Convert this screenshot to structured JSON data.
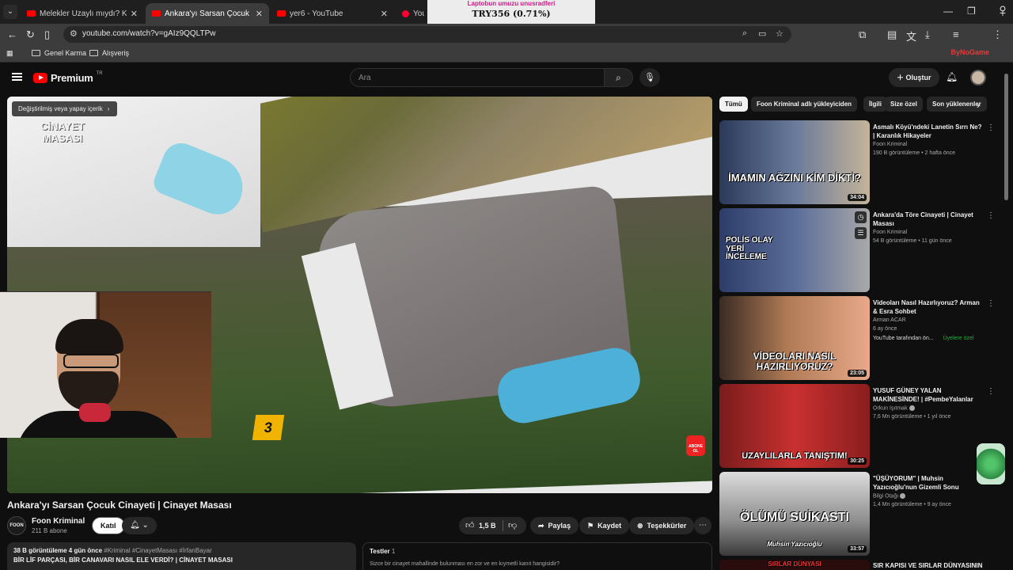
{
  "browser": {
    "tabs": [
      {
        "title": "Melekler Uzaylı mıydı? Kadim M",
        "icon": "youtube-icon",
        "active": false
      },
      {
        "title": "Ankara'yı Sarsan Çocuk Cinayeti",
        "icon": "youtube-icon",
        "active": true
      },
      {
        "title": "yer6 - YouTube",
        "icon": "youtube-icon",
        "active": false
      },
      {
        "title": "YouTube",
        "icon": "youtube-studio-icon",
        "active": false
      }
    ],
    "ticker_top": "Laptobun umuzu unusradferi",
    "ticker_value": "TRY356 (0.71%)",
    "url": "youtube.com/watch?v=gAIz9QQLTPw",
    "bookmarks": [
      "Genel Karma",
      "Alışveriş"
    ],
    "bynogame_label": "ByNoGame"
  },
  "youtube": {
    "logo_text": "Premium",
    "logo_region": "TR",
    "search_placeholder": "Ara",
    "create_label": "Oluştur"
  },
  "video": {
    "ai_chip": "Değiştirilmiş veya yapay içerik",
    "overlay_logo": "CİNAYET MASASI",
    "evidence_marker": "3",
    "subscribe_badge": "ABONE OL",
    "title": "Ankara'yı Sarsan Çocuk Cinayeti | Cinayet Masası",
    "channel_name": "Foon Kriminal",
    "channel_avatar_text": "FOON",
    "subscribers": "211 B abone",
    "join_label": "Katıl",
    "likes": "1,5 B",
    "share_label": "Paylaş",
    "save_label": "Kaydet",
    "thanks_label": "Teşekkürler",
    "desc_meta": "38 B görüntüleme  4 gün önce",
    "desc_tags": "#Kriminal #CinayetMasası #İrfanBayar",
    "desc_line2": "BİR LİF PARÇASI, BİR CANAVARI NASIL ELE VERDİ? | CİNAYET MASASI",
    "quiz_title": "Testler",
    "quiz_count": "1",
    "quiz_question": "Sizce bir cinayet mahallinde bulunması en zor ve en kıymetli kanıt hangisidir?"
  },
  "chips": [
    "Tümü",
    "Foon Kriminal adlı yükleyiciden",
    "İlgili",
    "Size özel",
    "Son yüklenenler"
  ],
  "recommendations": [
    {
      "title": "Asmalı Köyü'ndeki Lanetin Sırrı Ne? | Karanlık Hikayeler",
      "channel": "Foon Kriminal",
      "meta": "190 B görüntüleme • 2 hafta önce",
      "duration": "34:04",
      "thumb_text": "İMAMIN AĞZINI KİM DİKTİ?"
    },
    {
      "title": "Ankara'da Töre Cinayeti | Cinayet Masası",
      "channel": "Foon Kriminal",
      "meta": "54 B görüntüleme • 11 gün önce",
      "duration": "",
      "thumb_text": "POLİS OLAY YERİ İNCELEME"
    },
    {
      "title": "Videoları Nasıl Hazırlıyoruz? Arman & Esra Sohbet",
      "channel": "Arman ACAR",
      "meta": "6 ay önce",
      "meta2": "YouTube tarafından ön...",
      "badge": "Üyelere özel",
      "duration": "23:05",
      "thumb_text": "VİDEOLARI NASIL HAZIRLIYORUZ?"
    },
    {
      "title": "YUSUF GÜNEY YALAN MAKİNESİNDE! | #PembeYalanlar",
      "channel": "Orkun Işıtmak",
      "meta": "7,6 Mn görüntüleme • 1 yıl önce",
      "duration": "30:25",
      "thumb_text": "UZAYLILARLA TANIŞTIM!"
    },
    {
      "title": "\"ÜŞÜYORUM\" | Muhsin Yazıcıoğlu'nun Gizemli Sonu",
      "channel": "Bilgi Otağı",
      "meta": "1,4 Mn görüntüleme • 9 ay önce",
      "duration": "33:57",
      "thumb_text": "ÖLÜMÜ SUİKASTI",
      "thumb_sub": "Muhsin Yazıcıoğlu"
    },
    {
      "title": "SIR KAPISI VE SIRLAR DÜNYASININ",
      "channel": "",
      "meta": "",
      "duration": "",
      "thumb_text": "SIRLAR DÜNYASI"
    }
  ],
  "colors": {
    "accent": "#ff0000",
    "members_badge": "#2ba640",
    "ticker_top": "#d1178a"
  }
}
